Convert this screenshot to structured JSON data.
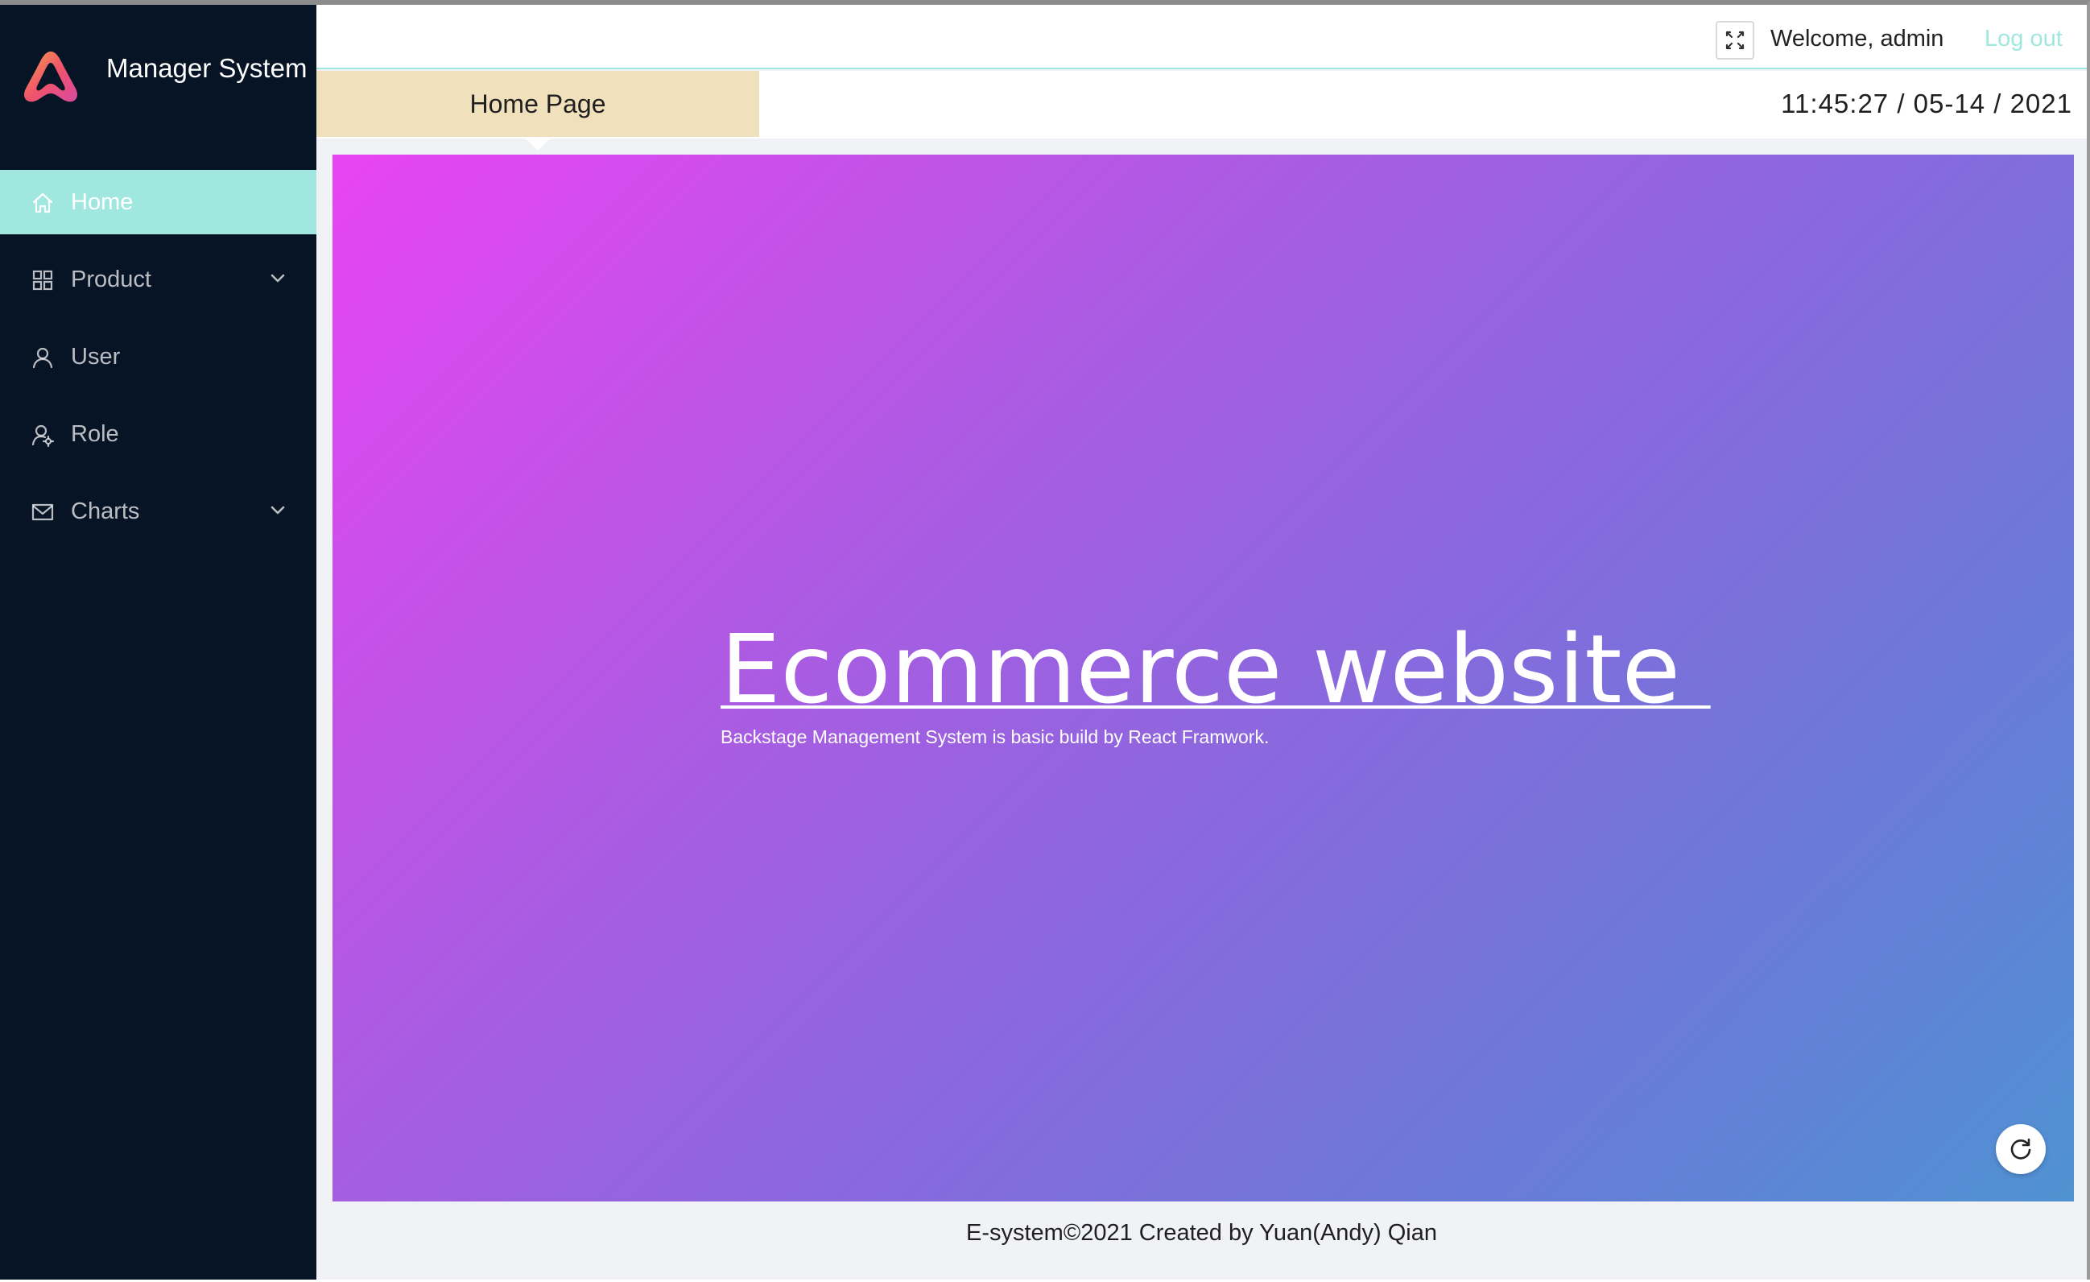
{
  "brand": {
    "title": "Manager System"
  },
  "sidebar": {
    "items": [
      {
        "label": "Home",
        "icon": "home-icon",
        "active": true,
        "has_submenu": false
      },
      {
        "label": "Product",
        "icon": "appstore-icon",
        "active": false,
        "has_submenu": true
      },
      {
        "label": "User",
        "icon": "user-icon",
        "active": false,
        "has_submenu": false
      },
      {
        "label": "Role",
        "icon": "role-icon",
        "active": false,
        "has_submenu": false
      },
      {
        "label": "Charts",
        "icon": "mail-icon",
        "active": false,
        "has_submenu": true
      }
    ]
  },
  "header": {
    "welcome": "Welcome, admin",
    "logout": "Log out"
  },
  "subheader": {
    "tab": "Home Page",
    "clock": "11:45:27 / 05-14 / 2021"
  },
  "hero": {
    "title": "Ecommerce website ",
    "subtitle": "Backstage Management System is basic build by React Framwork."
  },
  "footer": {
    "text": "E-system©2021 Created by Yuan(Andy) Qian"
  },
  "colors": {
    "sidebar_bg": "#061426",
    "accent": "#a0e7e0",
    "tab_bg": "#f1e0bc",
    "gradient_start": "#e844f2",
    "gradient_end": "#4f92d2"
  }
}
